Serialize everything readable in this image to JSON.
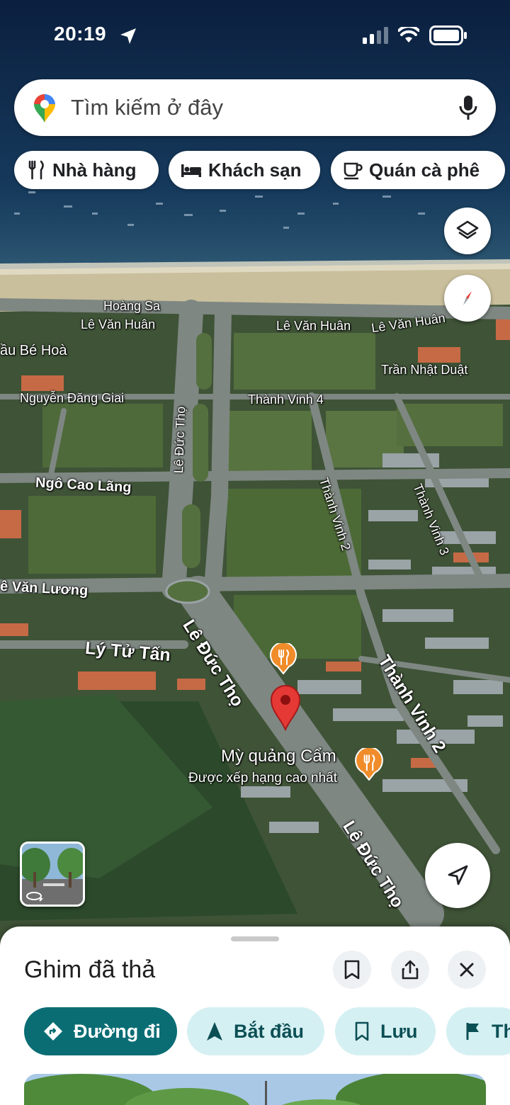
{
  "status_bar": {
    "time": "20:19"
  },
  "search": {
    "placeholder": "Tìm kiếm ở đây"
  },
  "chips": [
    {
      "label": "Nhà hàng",
      "icon": "restaurant-icon"
    },
    {
      "label": "Khách sạn",
      "icon": "hotel-icon"
    },
    {
      "label": "Quán cà phê",
      "icon": "coffee-icon"
    }
  ],
  "map": {
    "labels": {
      "hoang_sa": "Hoàng Sa",
      "le_van_huan_1": "Lê Văn Huân",
      "le_van_huan_2": "Lê Văn Huân",
      "le_van_huan_3": "Lê Văn Huân",
      "bau_be_hoa": "ầu Bé Hoà",
      "tran_nhat_duat": "Trần Nhật Duật",
      "nguyen_dang_giai": "Nguyễn Đăng Giai",
      "thanh_vinh_4": "Thành Vinh 4",
      "le_duc_tho_1": "Lê Đức Thọ",
      "ngo_cao_lang": "Ngô Cao Lãng",
      "thanh_vinh_2_a": "Thành Vinh 2",
      "thanh_vinh_3": "Thành Vinh 3",
      "le_van_luong": "ê Văn Lương",
      "ly_tu_tan": "Lý Tử Tấn",
      "le_duc_tho_2": "Lê Đức Thọ",
      "thanh_vinh_2_b": "Thành Vinh 2",
      "le_duc_tho_3": "Lê Đức Thọ"
    },
    "place": {
      "name": "Mỳ quảng Cẩm",
      "subtitle": "Được xếp hạng cao nhất"
    }
  },
  "sheet": {
    "title": "Ghim đã thả",
    "actions": [
      {
        "label": "Đường đi",
        "icon": "directions-icon"
      },
      {
        "label": "Bắt đầu",
        "icon": "navigation-arrow-icon"
      },
      {
        "label": "Lưu",
        "icon": "bookmark-icon"
      },
      {
        "label": "Th",
        "icon": "flag-icon"
      }
    ]
  },
  "colors": {
    "accent": "#0b6d74",
    "accent_light": "#d5f0f2",
    "pin": "#e53935",
    "poi": "#f08c2a"
  }
}
